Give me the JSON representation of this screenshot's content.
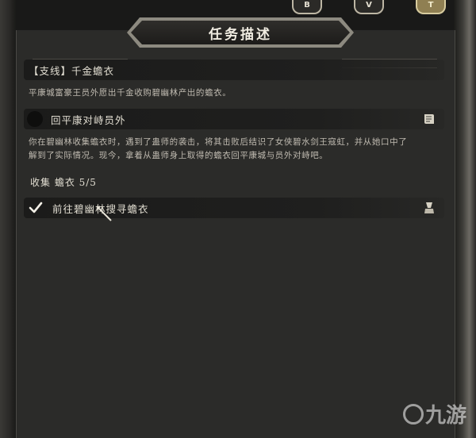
{
  "header": {
    "title": "任务描述",
    "buttons": [
      {
        "label": "B",
        "icon": "hex-b-icon"
      },
      {
        "label": "V",
        "icon": "hex-v-icon"
      },
      {
        "label": "T",
        "icon": "hex-t-icon"
      }
    ]
  },
  "quest": {
    "name": "【支线】千金蟾衣",
    "summary": "平康城富豪王员外愿出千金收购碧幽林产出的蟾衣。",
    "step": {
      "label": "回平康对峙员外",
      "icon": "scroll-icon",
      "description_line1": "你在碧幽林收集蟾衣时，遇到了蛊师的袭击，将其击败后结识了女侠碧水剑王寇虹，并从她口中了",
      "description_line2": "解到了实际情况。现今，拿着从蛊师身上取得的蟾衣回平康城与员外对峙吧。"
    },
    "progress": {
      "label": "收集 蟾衣 5/5",
      "current": 5,
      "total": 5
    },
    "completed_step": {
      "label": "前往碧幽林搜寻蟾衣",
      "status_icon": "checkmark-icon",
      "icon": "scroll-bell-icon"
    }
  },
  "watermark": {
    "text": "九游",
    "icon": "jiuyou-logo-icon"
  },
  "colors": {
    "panel": "#2b2b29",
    "bar": "#1b1b1a",
    "gold_button": "#8f7f52"
  }
}
